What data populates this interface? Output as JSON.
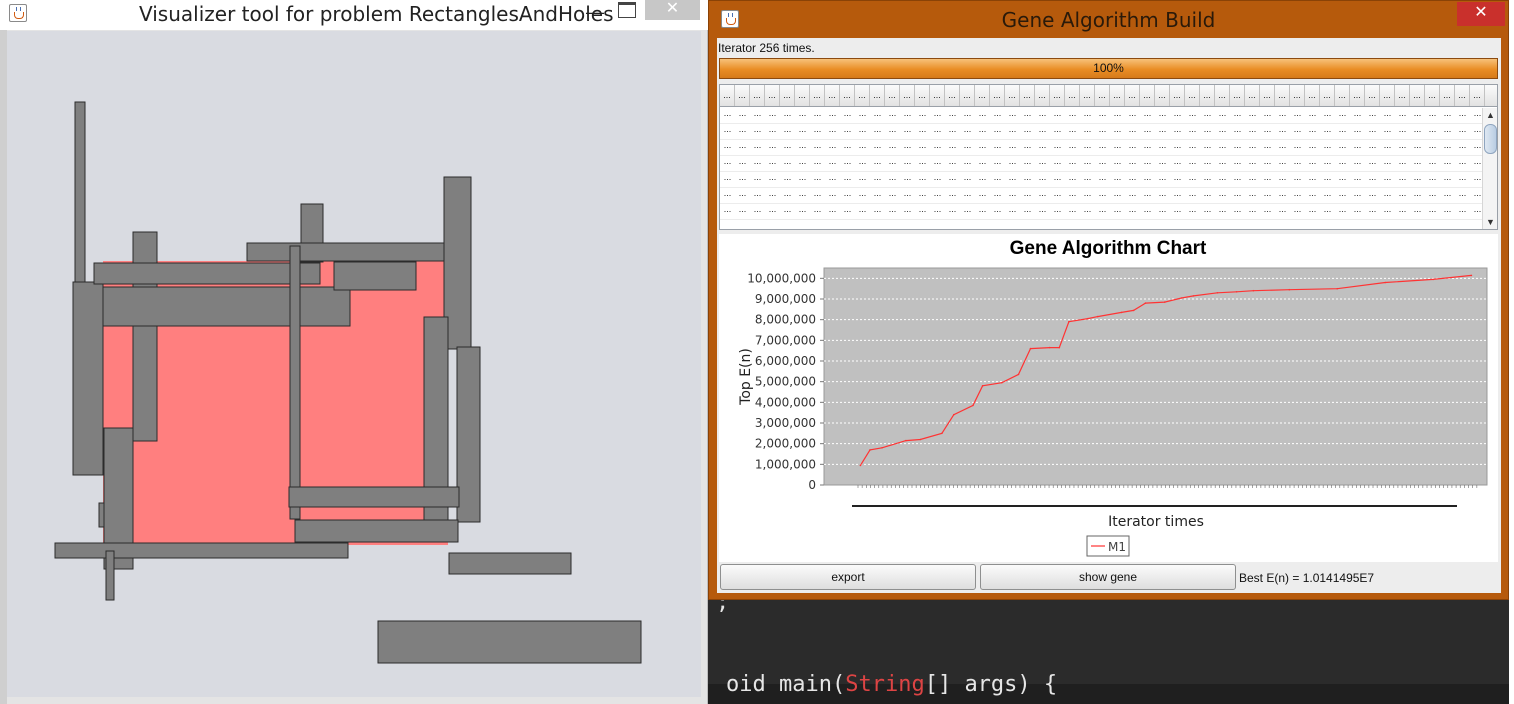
{
  "visualizer": {
    "title": "Visualizer tool for problem RectanglesAndHoles",
    "minimize": "—",
    "close": "✕",
    "colors": {
      "background": "#d9dbe1",
      "rect_fill": "#7f7f7f",
      "hole_fill": "#ff7f7f"
    }
  },
  "gene_window": {
    "title": "Gene Algorithm Build",
    "close": "✕",
    "status": "Iterator 256 times.",
    "progress": {
      "percent": 100,
      "label": "100%"
    },
    "table": {
      "cell_text": "...",
      "columns": 51,
      "rows": 7
    },
    "buttons": {
      "export": "export",
      "show_gene": "show gene"
    },
    "best_text": "Best E(n) = 1.0141495E7",
    "accent": "#b65a0c"
  },
  "chart_data": {
    "type": "line",
    "title": "Gene Algorithm Chart",
    "xlabel": "Iterator times",
    "ylabel": "Top E(n)",
    "ylim": [
      0,
      10500000
    ],
    "yticks": [
      "0",
      "1,000,000",
      "2,000,000",
      "3,000,000",
      "4,000,000",
      "5,000,000",
      "6,000,000",
      "7,000,000",
      "8,000,000",
      "9,000,000",
      "10,000,000"
    ],
    "legend": "bottom-center",
    "grid": true,
    "series": [
      {
        "name": "M1",
        "color": "#ff3333",
        "x": [
          1,
          5,
          10,
          20,
          26,
          35,
          40,
          48,
          52,
          60,
          67,
          72,
          80,
          84,
          88,
          96,
          100,
          110,
          115,
          120,
          128,
          135,
          140,
          150,
          158,
          165,
          180,
          200,
          220,
          240,
          256
        ],
        "values": [
          950000,
          1700000,
          1800000,
          2150000,
          2200000,
          2500000,
          3400000,
          3850000,
          4800000,
          4950000,
          5350000,
          6600000,
          6650000,
          6650000,
          7900000,
          8050000,
          8150000,
          8350000,
          8450000,
          8800000,
          8850000,
          9050000,
          9150000,
          9300000,
          9350000,
          9400000,
          9450000,
          9500000,
          9800000,
          9950000,
          10141495
        ]
      }
    ]
  },
  "editor": {
    "fragment": ";",
    "code_prefix": "oid main(",
    "code_type": "String",
    "code_suffix": "[] args) {"
  }
}
